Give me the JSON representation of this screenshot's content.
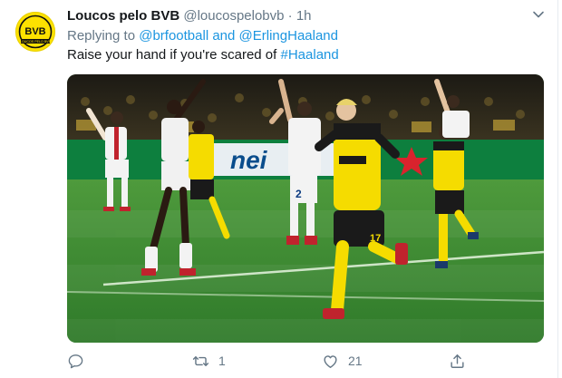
{
  "tweet": {
    "display_name": "Loucos pelo BVB",
    "handle": "@loucospelobvb",
    "separator": "·",
    "time": "1h",
    "replying_prefix": "Replying to",
    "replying_user1": "@brfootball",
    "replying_and": "and",
    "replying_user2": "@ErlingHaaland",
    "text_prefix": "Raise your hand if you're scared of",
    "hashtag": "#Haaland",
    "avatar_icon": "bvb-logo-icon",
    "avatar_letters": "BVB",
    "avatar_subtext": "LOUCOS PELO BVB",
    "media_icon": "match-photo",
    "banner_text": "nei",
    "player_number_17": "17",
    "player_number_2": "2"
  },
  "actions": {
    "reply_icon": "reply-icon",
    "retweet_icon": "retweet-icon",
    "retweet_count": "1",
    "like_icon": "heart-icon",
    "like_count": "21",
    "share_icon": "share-icon"
  },
  "colors": {
    "link": "#1b95e0",
    "muted": "#657786",
    "bvb_yellow": "#fde100",
    "pitch_green": "#3f8c33"
  }
}
